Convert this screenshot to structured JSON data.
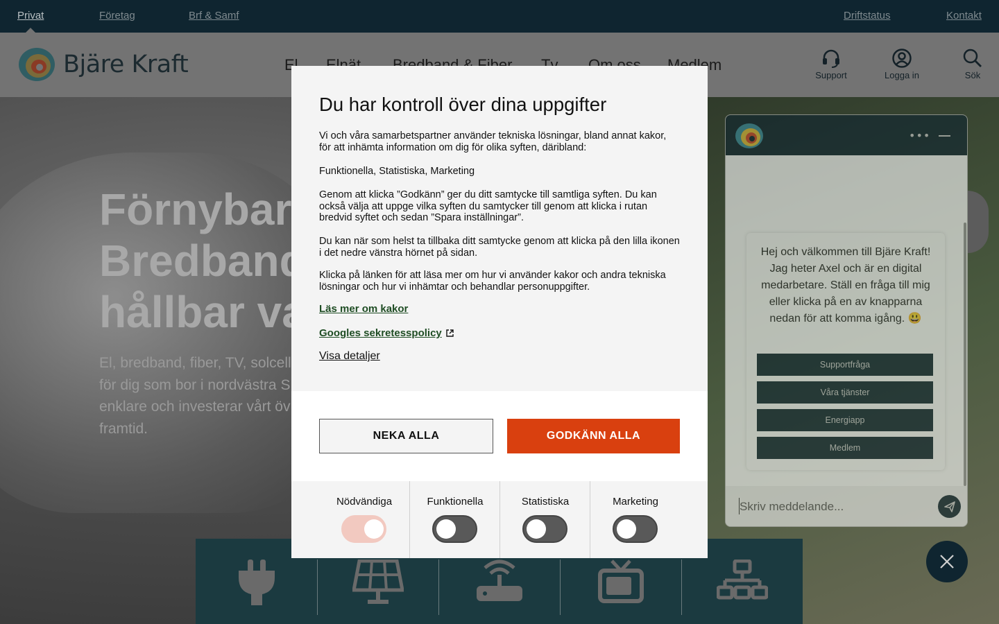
{
  "topbar": {
    "links_left": [
      "Privat",
      "Företag",
      "Brf & Samf"
    ],
    "links_right": [
      "Driftstatus",
      "Kontakt"
    ]
  },
  "header": {
    "brand": "Bjäre Kraft",
    "nav": [
      "El",
      "Elnät",
      "Bredband & Fiber",
      "Tv",
      "Om oss",
      "Medlem"
    ],
    "actions": {
      "support": "Support",
      "login": "Logga in",
      "search": "Sök"
    }
  },
  "hero": {
    "title_lines": [
      "Förnybar",
      "Bredband",
      "hållbar va"
    ],
    "lead": "El, bredband, fiber, TV, solcell för dig som bor i nordvästra S enklare och investerar vårt öv framtid."
  },
  "services": [
    "plug-icon",
    "solar-panel-icon",
    "router-icon",
    "tv-icon",
    "network-icon"
  ],
  "consent": {
    "title": "Du har kontroll över dina uppgifter",
    "intro": "Vi och våra samarbetspartner använder tekniska lösningar, bland annat kakor, för att inhämta information om dig för olika syften, däribland:",
    "purposes": "Funktionella, Statistiska, Marketing",
    "consent_text": "Genom att klicka ”Godkänn” ger du ditt samtycke till samtliga syften. Du kan också välja att uppge vilka syften du samtycker till genom att klicka i rutan bredvid syftet och sedan ”Spara inställningar”.",
    "withdraw_text": "Du kan när som helst ta tillbaka ditt samtycke genom att klicka på den lilla ikonen i det nedre vänstra hörnet på sidan.",
    "more_text": "Klicka på länken för att läsa mer om hur vi använder kakor och andra tekniska lösningar och hur vi inhämtar och behandlar personuppgifter.",
    "link_cookies": "Läs mer om kakor",
    "link_google": "Googles sekretesspolicy",
    "show_details": "Visa detaljer",
    "deny_label": "NEKA ALLA",
    "accept_label": "GODKÄNN ALLA",
    "accent_color": "#d9400f",
    "toggles": [
      {
        "label": "Nödvändiga",
        "on": true
      },
      {
        "label": "Funktionella",
        "on": false
      },
      {
        "label": "Statistiska",
        "on": false
      },
      {
        "label": "Marketing",
        "on": false
      }
    ]
  },
  "chat": {
    "greeting": "Hej och välkommen till Bjäre Kraft! Jag heter Axel och är en digital medarbetare. Ställ en fråga till mig eller klicka på en av knapparna nedan för att komma igång. 😃",
    "quick_replies": [
      "Supportfråga",
      "Våra tjänster",
      "Energiapp",
      "Medlem"
    ],
    "input_placeholder": "Skriv meddelande..."
  }
}
